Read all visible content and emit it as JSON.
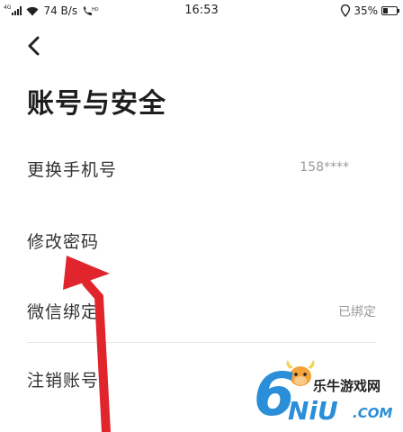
{
  "status_bar": {
    "network_tag": "4G",
    "speed": "74 B/s",
    "hd_label": "HD",
    "time": "16:53",
    "battery_percent": "35%",
    "battery_level": 0.35
  },
  "header": {
    "back_icon": "chevron-left-icon",
    "title": "账号与安全"
  },
  "settings": [
    {
      "label": "更换手机号",
      "value": "158****"
    },
    {
      "label": "修改密码",
      "value": ""
    },
    {
      "label": "微信绑定",
      "value": "已绑定"
    },
    {
      "label": "注销账号",
      "value": ""
    }
  ],
  "annotation": {
    "arrow_color": "#e0262c",
    "target": "修改密码"
  },
  "watermark": {
    "digit": "6",
    "text_cn": "乐牛游戏网",
    "brand": "NiU",
    "domain": ".COM"
  },
  "colors": {
    "accent": "#2a8fd8",
    "text": "#333333",
    "muted": "#9a9a9a"
  }
}
